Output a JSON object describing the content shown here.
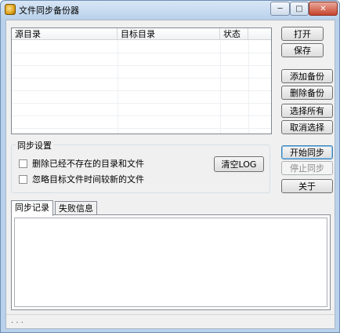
{
  "window": {
    "title": "文件同步备份器",
    "minimize_glyph": "─",
    "maximize_glyph": "□",
    "close_glyph": "✕"
  },
  "backup_list": {
    "columns": [
      "源目录",
      "目标目录",
      "状态"
    ]
  },
  "side_buttons": {
    "open": "打开",
    "save": "保存",
    "add_backup": "添加备份",
    "delete_backup": "删除备份",
    "select_all": "选择所有",
    "cancel_select": "取消选择",
    "start_sync": "开始同步",
    "stop_sync": "停止同步",
    "about": "关于"
  },
  "sync_settings": {
    "title": "同步设置",
    "option_delete": "删除已经不存在的目录和文件",
    "option_ignore": "忽略目标文件时间较新的文件",
    "clear_log": "清空LOG"
  },
  "tabs": [
    "同步记录",
    "失败信息"
  ],
  "status_text": ". . ."
}
